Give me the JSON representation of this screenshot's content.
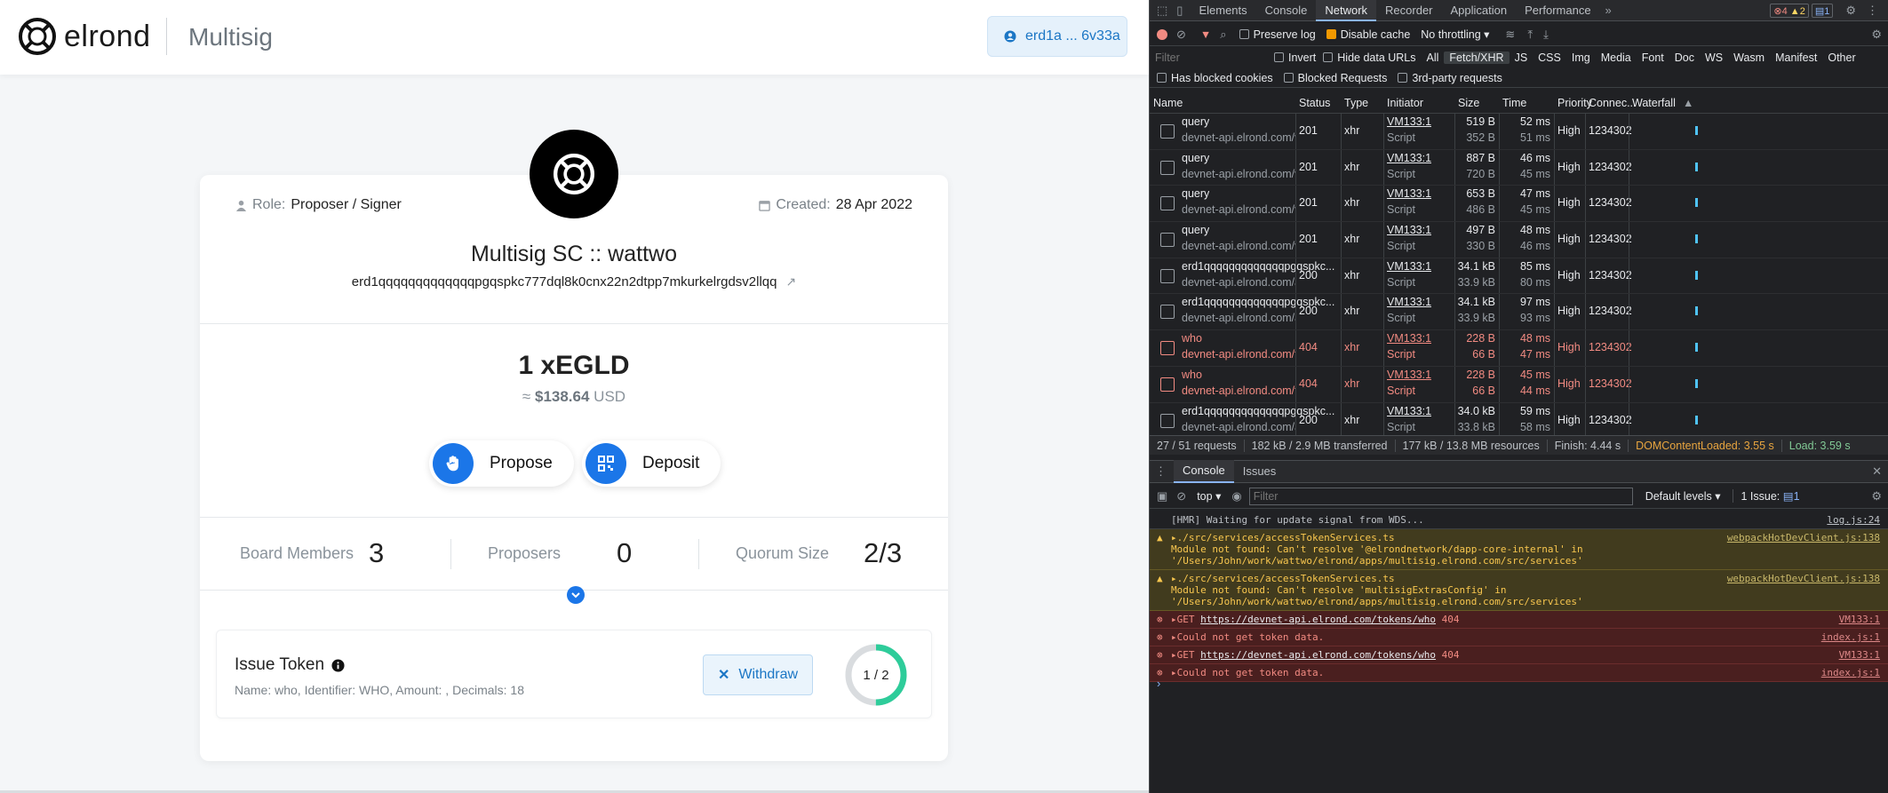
{
  "app": {
    "brand": "elrond",
    "title": "Multisig",
    "address_short": "erd1a ... 6v33a",
    "card": {
      "role_label": "Role:",
      "role_value": "Proposer / Signer",
      "created_label": "Created:",
      "created_value": "28 Apr 2022",
      "name": "Multisig SC :: wattwo",
      "address": "erd1qqqqqqqqqqqqqpgqspkc777dql8k0cnx22n2dtpp7mkurkelrgdsv2llqq",
      "balance": "1 xEGLD",
      "usd_prefix": "≈",
      "usd_value": "$138.64",
      "usd_suffix": "USD",
      "propose_label": "Propose",
      "deposit_label": "Deposit",
      "stats": [
        {
          "label": "Board Members",
          "value": "3"
        },
        {
          "label": "Proposers",
          "value": "0"
        },
        {
          "label": "Quorum Size",
          "value": "2/3"
        }
      ],
      "proposal": {
        "title": "Issue Token",
        "description": "Name: who, Identifier: WHO, Amount: , Decimals: 18",
        "withdraw_label": "Withdraw",
        "votes_text": "1 / 2",
        "votes_fraction": 0.5
      }
    },
    "colors": {
      "accent": "#1b76e8",
      "vote_ring": "#2ecc9a"
    }
  },
  "devtools": {
    "tabs": [
      "Elements",
      "Console",
      "Network",
      "Recorder",
      "Application",
      "Performance"
    ],
    "active_tab": "Network",
    "badges": {
      "errors": "4",
      "warnings": "2",
      "messages": "1"
    },
    "toolbar": {
      "preserve_log": "Preserve log",
      "disable_cache": "Disable cache",
      "throttling": "No throttling"
    },
    "filter": {
      "placeholder": "Filter",
      "invert": "Invert",
      "hide_data_urls": "Hide data URLs",
      "types": [
        "All",
        "Fetch/XHR",
        "JS",
        "CSS",
        "Img",
        "Media",
        "Font",
        "Doc",
        "WS",
        "Wasm",
        "Manifest",
        "Other"
      ],
      "active_type": "Fetch/XHR",
      "has_blocked_cookies": "Has blocked cookies",
      "blocked_requests": "Blocked Requests",
      "third_party": "3rd-party requests"
    },
    "columns": [
      "Name",
      "Status",
      "Type",
      "Initiator",
      "Size",
      "Time",
      "Priority",
      "Connec...",
      "Waterfall"
    ],
    "rows": [
      {
        "name": "query",
        "host": "devnet-api.elrond.com/vm-val...",
        "status": "201",
        "type": "xhr",
        "initiator": "VM133:1",
        "initiator_sub": "Script",
        "size": "519 B",
        "size_sub": "352 B",
        "time": "52 ms",
        "time_sub": "51 ms",
        "priority": "High",
        "conn": "1234302",
        "error": false
      },
      {
        "name": "query",
        "host": "devnet-api.elrond.com/vm-val...",
        "status": "201",
        "type": "xhr",
        "initiator": "VM133:1",
        "initiator_sub": "Script",
        "size": "887 B",
        "size_sub": "720 B",
        "time": "46 ms",
        "time_sub": "45 ms",
        "priority": "High",
        "conn": "1234302",
        "error": false
      },
      {
        "name": "query",
        "host": "devnet-api.elrond.com/vm-val...",
        "status": "201",
        "type": "xhr",
        "initiator": "VM133:1",
        "initiator_sub": "Script",
        "size": "653 B",
        "size_sub": "486 B",
        "time": "47 ms",
        "time_sub": "45 ms",
        "priority": "High",
        "conn": "1234302",
        "error": false
      },
      {
        "name": "query",
        "host": "devnet-api.elrond.com/vm-val...",
        "status": "201",
        "type": "xhr",
        "initiator": "VM133:1",
        "initiator_sub": "Script",
        "size": "497 B",
        "size_sub": "330 B",
        "time": "48 ms",
        "time_sub": "46 ms",
        "priority": "High",
        "conn": "1234302",
        "error": false
      },
      {
        "name": "erd1qqqqqqqqqqqqqpgqspkc...",
        "host": "devnet-api.elrond.com/accounts",
        "status": "200",
        "type": "xhr",
        "initiator": "VM133:1",
        "initiator_sub": "Script",
        "size": "34.1 kB",
        "size_sub": "33.9 kB",
        "time": "85 ms",
        "time_sub": "80 ms",
        "priority": "High",
        "conn": "1234302",
        "error": false
      },
      {
        "name": "erd1qqqqqqqqqqqqqpgqspkc...",
        "host": "devnet-api.elrond.com/accounts",
        "status": "200",
        "type": "xhr",
        "initiator": "VM133:1",
        "initiator_sub": "Script",
        "size": "34.1 kB",
        "size_sub": "33.9 kB",
        "time": "97 ms",
        "time_sub": "93 ms",
        "priority": "High",
        "conn": "1234302",
        "error": false
      },
      {
        "name": "who",
        "host": "devnet-api.elrond.com/tokens",
        "status": "404",
        "type": "xhr",
        "initiator": "VM133:1",
        "initiator_sub": "Script",
        "size": "228 B",
        "size_sub": "66 B",
        "time": "48 ms",
        "time_sub": "47 ms",
        "priority": "High",
        "conn": "1234302",
        "error": true
      },
      {
        "name": "who",
        "host": "devnet-api.elrond.com/tokens",
        "status": "404",
        "type": "xhr",
        "initiator": "VM133:1",
        "initiator_sub": "Script",
        "size": "228 B",
        "size_sub": "66 B",
        "time": "45 ms",
        "time_sub": "44 ms",
        "priority": "High",
        "conn": "1234302",
        "error": true
      },
      {
        "name": "erd1qqqqqqqqqqqqqpgqspkc...",
        "host": "devnet-api.elrond.com/address",
        "status": "200",
        "type": "xhr",
        "initiator": "VM133:1",
        "initiator_sub": "Script",
        "size": "34.0 kB",
        "size_sub": "33.8 kB",
        "time": "59 ms",
        "time_sub": "58 ms",
        "priority": "High",
        "conn": "1234302",
        "error": false
      }
    ],
    "summary": {
      "requests": "27 / 51 requests",
      "transferred": "182 kB / 2.9 MB transferred",
      "resources": "177 kB / 13.8 MB resources",
      "finish": "Finish: 4.44 s",
      "dom_loaded": "DOMContentLoaded: 3.55 s",
      "load": "Load: 3.59 s"
    },
    "drawer": {
      "tabs": [
        "Console",
        "Issues"
      ],
      "context": "top",
      "filter_placeholder": "Filter",
      "levels": "Default levels",
      "issues": "1 Issue:",
      "issues_count": "1"
    },
    "console": [
      {
        "level": "info",
        "text": "[HMR] Waiting for update signal from WDS...",
        "source": "log.js:24"
      },
      {
        "level": "warn",
        "text": "▸./src/services/accessTokenServices.ts",
        "line2": "Module not found: Can't resolve '@elrondnetwork/dapp-core-internal' in",
        "line3": "'/Users/John/work/wattwo/elrond/apps/multisig.elrond.com/src/services'",
        "source": "webpackHotDevClient.js:138"
      },
      {
        "level": "warn",
        "text": "▸./src/services/accessTokenServices.ts",
        "line2": "Module not found: Can't resolve 'multisigExtrasConfig' in",
        "line3": "'/Users/John/work/wattwo/elrond/apps/multisig.elrond.com/src/services'",
        "source": "webpackHotDevClient.js:138"
      },
      {
        "level": "error",
        "prefix": "▸GET ",
        "url": "https://devnet-api.elrond.com/tokens/who",
        "code": "404",
        "source": "VM133:1"
      },
      {
        "level": "error",
        "text": "▸Could not get token data.",
        "source": "index.js:1"
      },
      {
        "level": "error",
        "prefix": "▸GET ",
        "url": "https://devnet-api.elrond.com/tokens/who",
        "code": "404",
        "source": "VM133:1"
      },
      {
        "level": "error",
        "text": "▸Could not get token data.",
        "source": "index.js:1"
      }
    ],
    "prompt": "›"
  }
}
